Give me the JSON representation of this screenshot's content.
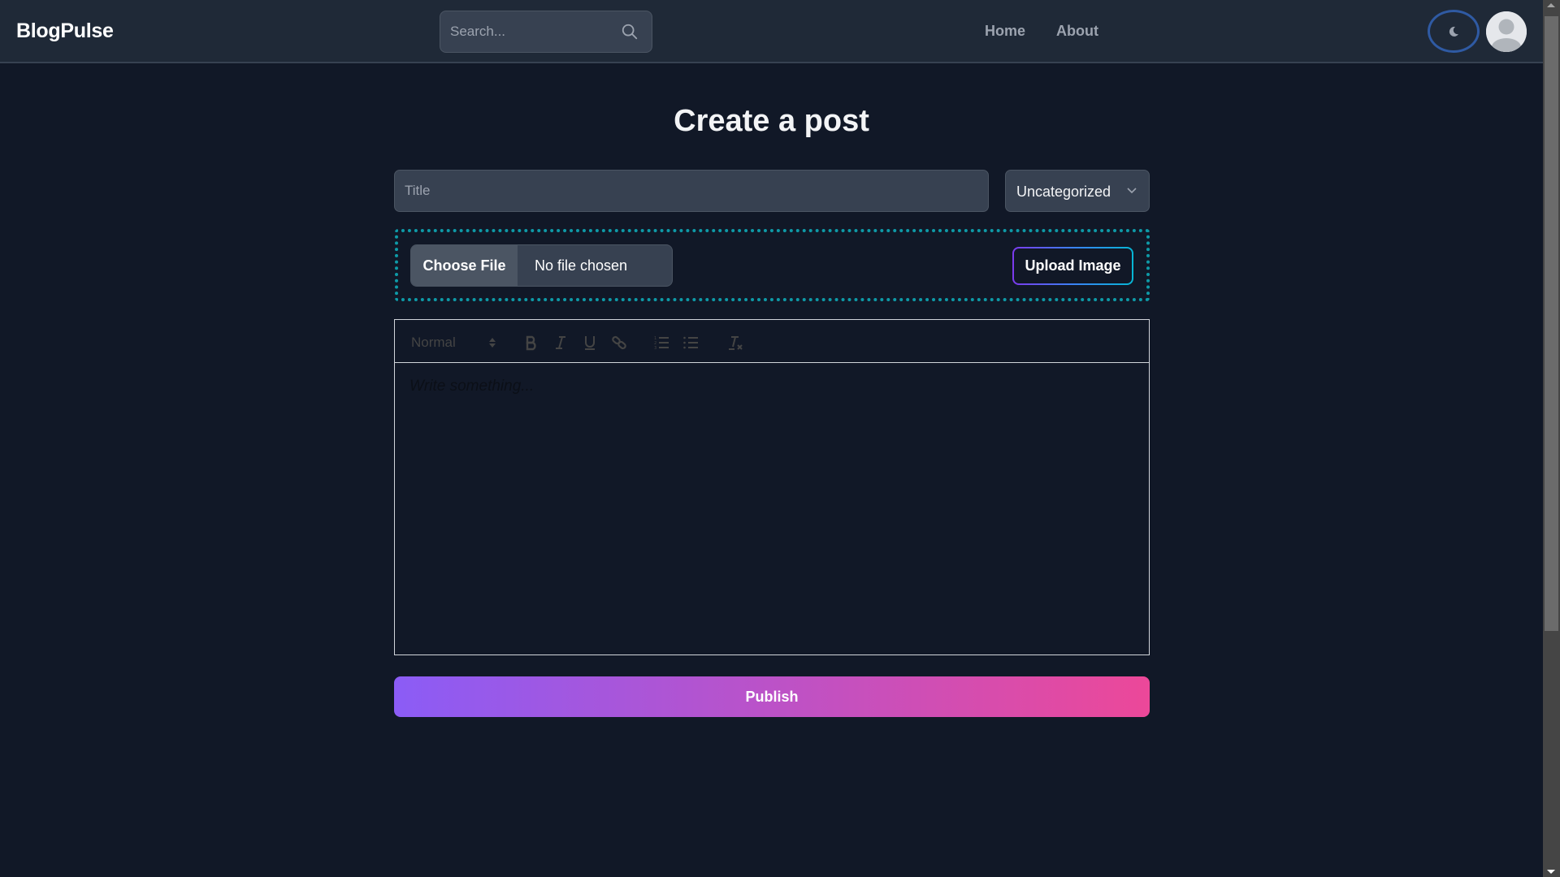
{
  "navbar": {
    "brand": "BlogPulse",
    "search": {
      "placeholder": "Search...",
      "value": "",
      "icon": "search-icon"
    },
    "links": [
      {
        "label": "Home"
      },
      {
        "label": "About"
      }
    ],
    "theme_toggle": {
      "icon": "moon-icon"
    },
    "avatar": {
      "icon": "user-avatar-icon"
    }
  },
  "page": {
    "title": "Create a post"
  },
  "form": {
    "title_field": {
      "placeholder": "Title",
      "value": ""
    },
    "category": {
      "selected": "Uncategorized",
      "icon": "chevron-down-icon"
    },
    "file": {
      "button_label": "Choose File",
      "status": "No file chosen"
    },
    "upload_button": "Upload Image",
    "editor": {
      "header_select": "Normal",
      "toolbar": [
        "bold",
        "italic",
        "underline",
        "link",
        "ordered-list",
        "bullet-list",
        "clear-format"
      ],
      "placeholder": "Write something..."
    },
    "publish_button": "Publish"
  },
  "colors": {
    "background": "#111827",
    "navbar": "#1f2937",
    "input": "#374151",
    "accent_dotted": "#0e9aa7",
    "publish_gradient_start": "#8b5cf6",
    "publish_gradient_end": "#ec4899"
  }
}
